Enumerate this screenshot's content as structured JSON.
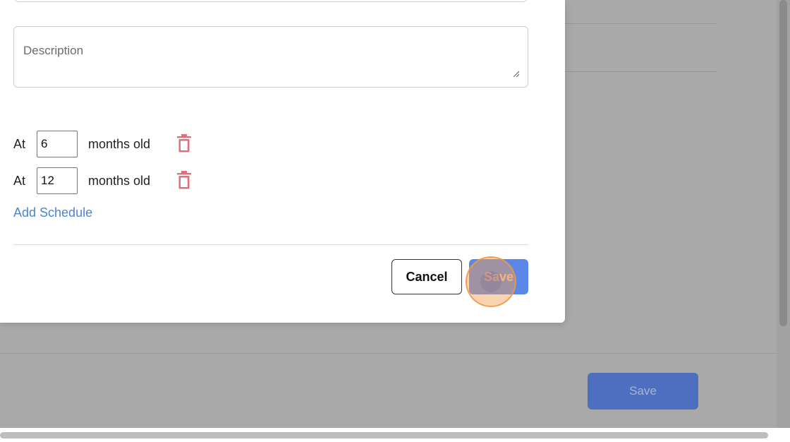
{
  "modal": {
    "description_placeholder": "Description",
    "schedules": [
      {
        "prefix": "At",
        "value": "6",
        "suffix": "months old",
        "delete_icon": "trash-icon"
      },
      {
        "prefix": "At",
        "value": "12",
        "suffix": "months old",
        "delete_icon": "trash-icon"
      }
    ],
    "add_schedule_label": "Add Schedule",
    "cancel_label": "Cancel",
    "save_label": "Save"
  },
  "background_page": {
    "save_label": "Save"
  },
  "colors": {
    "accent_blue": "#5b88e6",
    "link_blue": "#4a86d0",
    "delete_red": "#e0707a",
    "overlay_gray": "#a9a9a9"
  }
}
